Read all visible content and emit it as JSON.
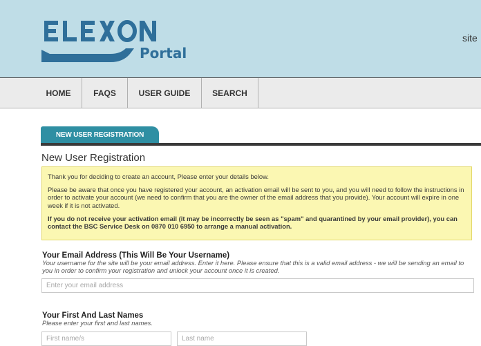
{
  "brand": {
    "logo_text": "ELEXON",
    "logo_sub": "Portal",
    "header_right": "site",
    "colors": {
      "header_bg": "#bfdde7",
      "logo_blue": "#2f6f9a",
      "accent": "#2f8fa3"
    }
  },
  "nav": {
    "items": [
      {
        "label": "HOME"
      },
      {
        "label": "FAQS"
      },
      {
        "label": "USER GUIDE"
      },
      {
        "label": "SEARCH"
      }
    ]
  },
  "page": {
    "tab_label": "NEW USER REGISTRATION",
    "title": "New User Registration"
  },
  "notice": {
    "p1": "Thank you for deciding to create an account, Please enter your details below.",
    "p2": "Please be aware that once you have registered your account, an activation email will be sent to you, and you will need to follow the instructions in order to activate your account (we need to confirm that you are the owner of the email address that you provide). Your account will expire in one week if it is not activated.",
    "p3": "If you do not receive your activation email (it may be incorrectly be seen as \"spam\" and quarantined by your email provider), you can contact the BSC Service Desk on 0870 010 6950 to arrange a manual activation."
  },
  "form": {
    "email": {
      "label": "Your Email Address (This Will Be Your Username)",
      "help": "Your username for the site will be your email address. Enter it here. Please ensure that this is a valid email address - we will be sending an email to you in order to confirm your registration and unlock your account once it is created.",
      "placeholder": "Enter your email address",
      "value": ""
    },
    "names": {
      "label": "Your First And Last Names",
      "help": "Please enter your first and last names.",
      "first_placeholder": "First name/s",
      "last_placeholder": "Last name"
    }
  }
}
